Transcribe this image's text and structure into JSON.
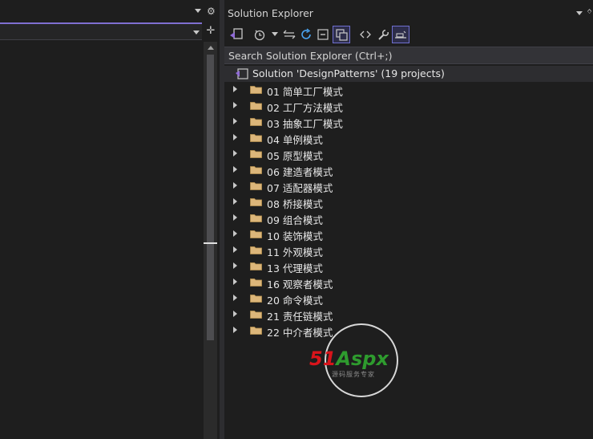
{
  "solution_explorer": {
    "title": "Solution Explorer",
    "search_placeholder": "Search Solution Explorer (Ctrl+;)",
    "solution_label": "Solution 'DesignPatterns' (19 projects)",
    "projects": [
      "01 简单工厂模式",
      "02 工厂方法模式",
      "03 抽象工厂模式",
      "04 单例模式",
      "05 原型模式",
      "06 建造者模式",
      "07 适配器模式",
      "08 桥接模式",
      "09 组合模式",
      "10 装饰模式",
      "11 外观模式",
      "13 代理模式",
      "16 观察者模式",
      "20 命令模式",
      "21 责任链模式",
      "22 中介者模式"
    ],
    "toolbar_icons": [
      "vs-switch-views-icon",
      "history-icon",
      "chevron-down-icon",
      "sync-icon",
      "refresh-icon",
      "collapse-all-icon",
      "show-all-files-icon",
      "code-view-icon",
      "properties-wrench-icon",
      "preview-selected-icon"
    ]
  },
  "watermark": {
    "brand_red": "51",
    "brand_green": "Aspx",
    "subtitle": "源码服务专家"
  },
  "colors": {
    "accent": "#7f6fd1",
    "folder": "#dcb67a",
    "background": "#1e1e1e"
  }
}
